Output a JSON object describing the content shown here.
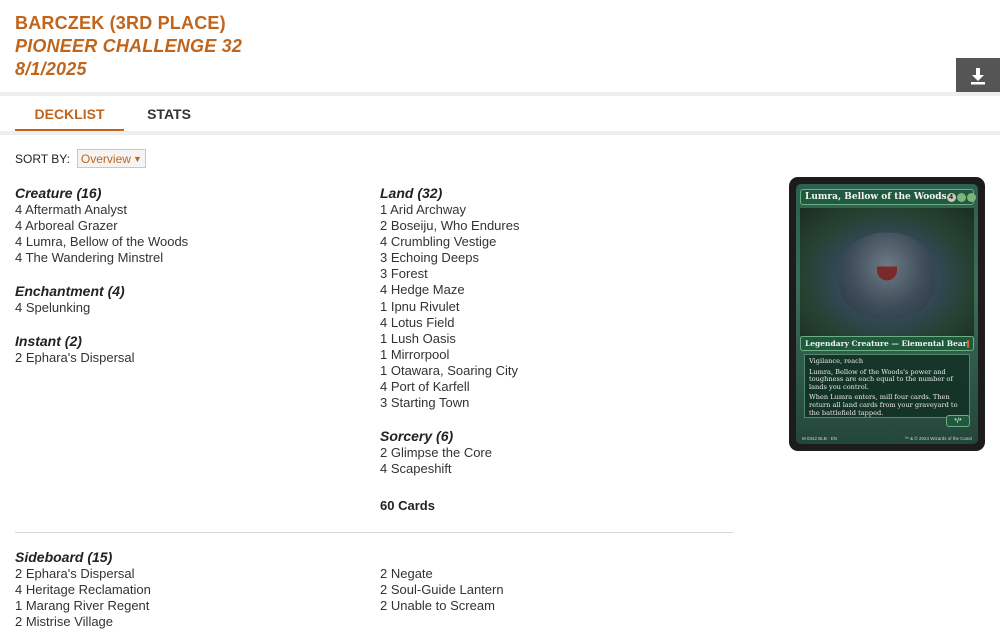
{
  "header": {
    "player": "BARCZEK (3RD PLACE)",
    "event": "PIONEER CHALLENGE 32",
    "date": "8/1/2025"
  },
  "download": {
    "icon": "download-icon"
  },
  "tabs": [
    {
      "label": "DECKLIST",
      "active": true
    },
    {
      "label": "STATS",
      "active": false
    }
  ],
  "sort": {
    "label": "SORT BY:",
    "value": "Overview"
  },
  "left_sections": [
    {
      "title": "Creature (16)",
      "cards": [
        "4 Aftermath Analyst",
        "4 Arboreal Grazer",
        "4 Lumra, Bellow of the Woods",
        "4 The Wandering Minstrel"
      ]
    },
    {
      "title": "Enchantment (4)",
      "cards": [
        "4 Spelunking"
      ]
    },
    {
      "title": "Instant (2)",
      "cards": [
        "2 Ephara's Dispersal"
      ]
    }
  ],
  "mid_sections": [
    {
      "title": "Land (32)",
      "cards": [
        "1 Arid Archway",
        "2 Boseiju, Who Endures",
        "4 Crumbling Vestige",
        "3 Echoing Deeps",
        "3 Forest",
        "4 Hedge Maze",
        "1 Ipnu Rivulet",
        "4 Lotus Field",
        "1 Lush Oasis",
        "1 Mirrorpool",
        "1 Otawara, Soaring City",
        "4 Port of Karfell",
        "3 Starting Town"
      ]
    },
    {
      "title": "Sorcery (6)",
      "cards": [
        "2 Glimpse the Core",
        "4 Scapeshift"
      ]
    }
  ],
  "total": "60 Cards",
  "sideboard": {
    "title": "Sideboard (15)",
    "left": [
      "2 Ephara's Dispersal",
      "4 Heritage Reclamation",
      "1 Marang River Regent",
      "2 Mistrise Village"
    ],
    "right": [
      "2 Negate",
      "2 Soul-Guide Lantern",
      "2 Unable to Scream"
    ]
  },
  "featured_card": {
    "name": "Lumra, Bellow of the Woods",
    "cost_generic": "4",
    "type_line": "Legendary Creature — Elemental Bear",
    "rules": [
      "Vigilance, reach",
      "Lumra, Bellow of the Woods's power and toughness are each equal to the number of lands you control.",
      "When Lumra enters, mill four cards. Then return all land cards from your graveyard to the battlefield tapped."
    ],
    "pt": "*/*",
    "footer_left": "M 0342 BLB · EN",
    "footer_right": "™ & © 2024 Wizards of the Coast"
  },
  "colors": {
    "accent": "#c0651b",
    "button_bg": "#555555"
  }
}
